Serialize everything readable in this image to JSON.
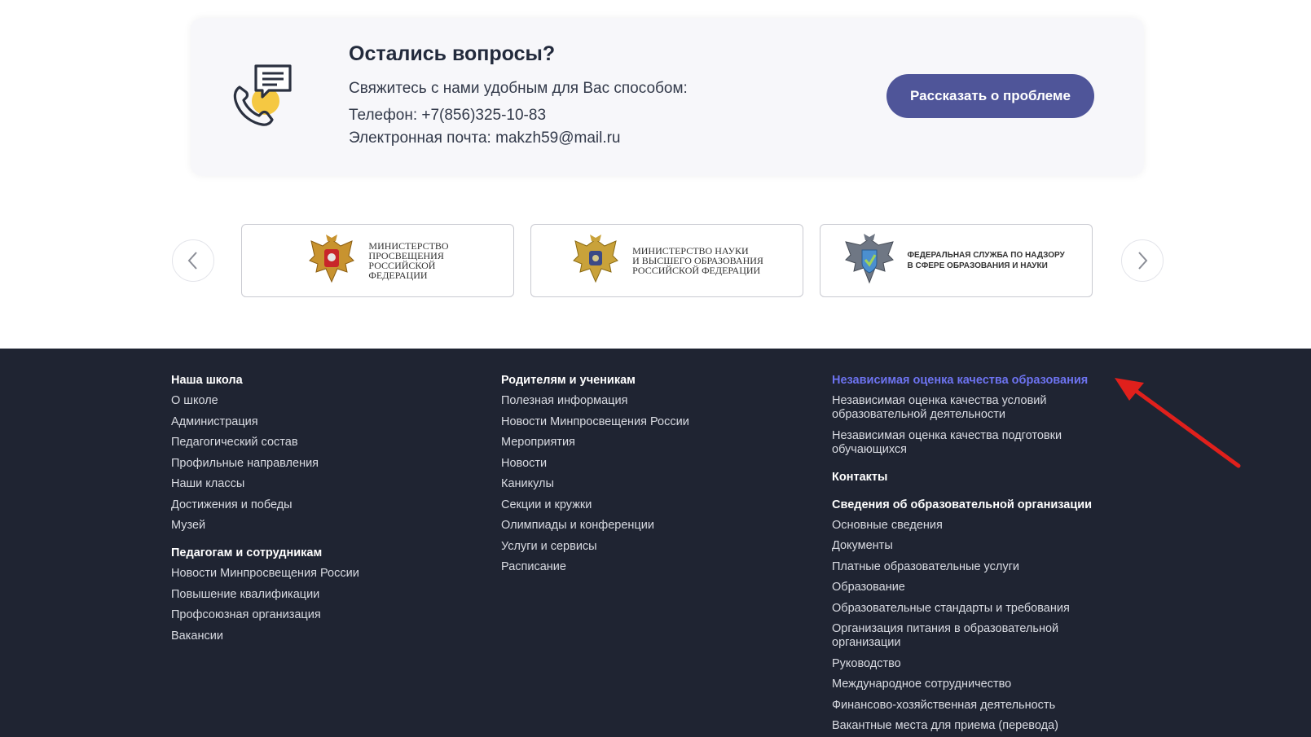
{
  "questions": {
    "title": "Остались вопросы?",
    "subtitle": "Свяжитесь с нами удобным для Вас способом:",
    "phone": "Телефон: +7(856)325-10-83",
    "email": "Электронная почта: makzh59@mail.ru",
    "button_label": "Рассказать о проблеме",
    "icon": "phone-chat-icon"
  },
  "partners": {
    "prev_icon": "chevron-left-icon",
    "next_icon": "chevron-right-icon",
    "logos": [
      {
        "text": "Министерство\nпросвещения\nРоссийской\nФедерации",
        "icon": "eagle-emblem-icon"
      },
      {
        "text": "Министерство науки\nи высшего образования\nРоссийской Федерации",
        "icon": "eagle-emblem-icon"
      },
      {
        "text": "Федеральная служба по надзору в сфере образования и науки",
        "icon": "eagle-shield-icon"
      }
    ]
  },
  "footer": {
    "col1": {
      "head1": "Наша школа",
      "links1": [
        "О школе",
        "Администрация",
        "Педагогический состав",
        "Профильные направления",
        "Наши классы",
        "Достижения и победы",
        "Музей"
      ],
      "head2": "Педагогам и сотрудникам",
      "links2": [
        "Новости Минпросвещения России",
        "Повышение квалификации",
        "Профсоюзная организация",
        "Вакансии"
      ]
    },
    "col2": {
      "head1": "Родителям и ученикам",
      "links1": [
        "Полезная информация",
        "Новости Минпросвещения России",
        "Мероприятия",
        "Новости",
        "Каникулы",
        "Секции и кружки",
        "Олимпиады и конференции",
        "Услуги и сервисы",
        "Расписание"
      ]
    },
    "col3": {
      "head1": "Независимая оценка качества образования",
      "links1": [
        "Независимая оценка качества условий образовательной деятельности",
        "Независимая оценка качества подготовки обучающихся"
      ],
      "head2": "Контакты",
      "head3": "Сведения об образовательной организации",
      "links3": [
        "Основные сведения",
        "Документы",
        "Платные образовательные услуги",
        "Образование",
        "Образовательные стандарты и требования",
        "Организация питания в образовательной организации",
        "Руководство",
        "Международное сотрудничество",
        "Финансово-хозяйственная деятельность",
        "Вакантные места для приема (перевода)"
      ]
    }
  },
  "colors": {
    "accent": "#4f5599",
    "footer_bg": "#1f2432",
    "highlight_link": "#6d73f0",
    "annotation_arrow": "#e0201c"
  }
}
